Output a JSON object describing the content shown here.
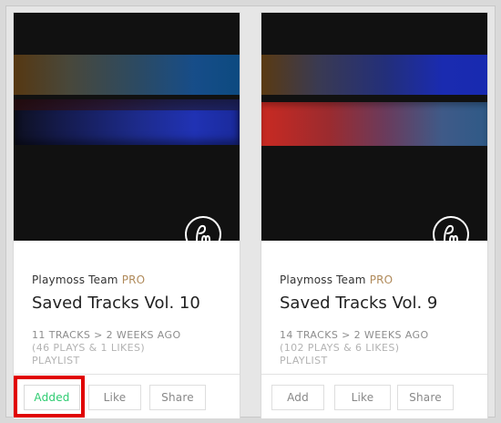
{
  "cards": [
    {
      "author": "Playmoss Team",
      "badge": "PRO",
      "title": "Saved Tracks Vol. 10",
      "meta": {
        "line1": "11 TRACKS > 2 WEEKS AGO",
        "line2": "(46 PLAYS & 1 LIKES)",
        "line3": "PLAYLIST"
      },
      "buttons": {
        "primary": "Added",
        "like": "Like",
        "share": "Share"
      }
    },
    {
      "author": "Playmoss Team",
      "badge": "PRO",
      "title": "Saved Tracks Vol. 9",
      "meta": {
        "line1": "14 TRACKS > 2 WEEKS AGO",
        "line2": "(102 PLAYS & 6 LIKES)",
        "line3": "PLAYLIST"
      },
      "buttons": {
        "primary": "Add",
        "like": "Like",
        "share": "Share"
      }
    }
  ],
  "colors": {
    "pro": "#b08a5a",
    "added": "#2ecc71",
    "highlight": "#e00000"
  },
  "icons": {
    "logo": "playmoss-logo-icon"
  }
}
